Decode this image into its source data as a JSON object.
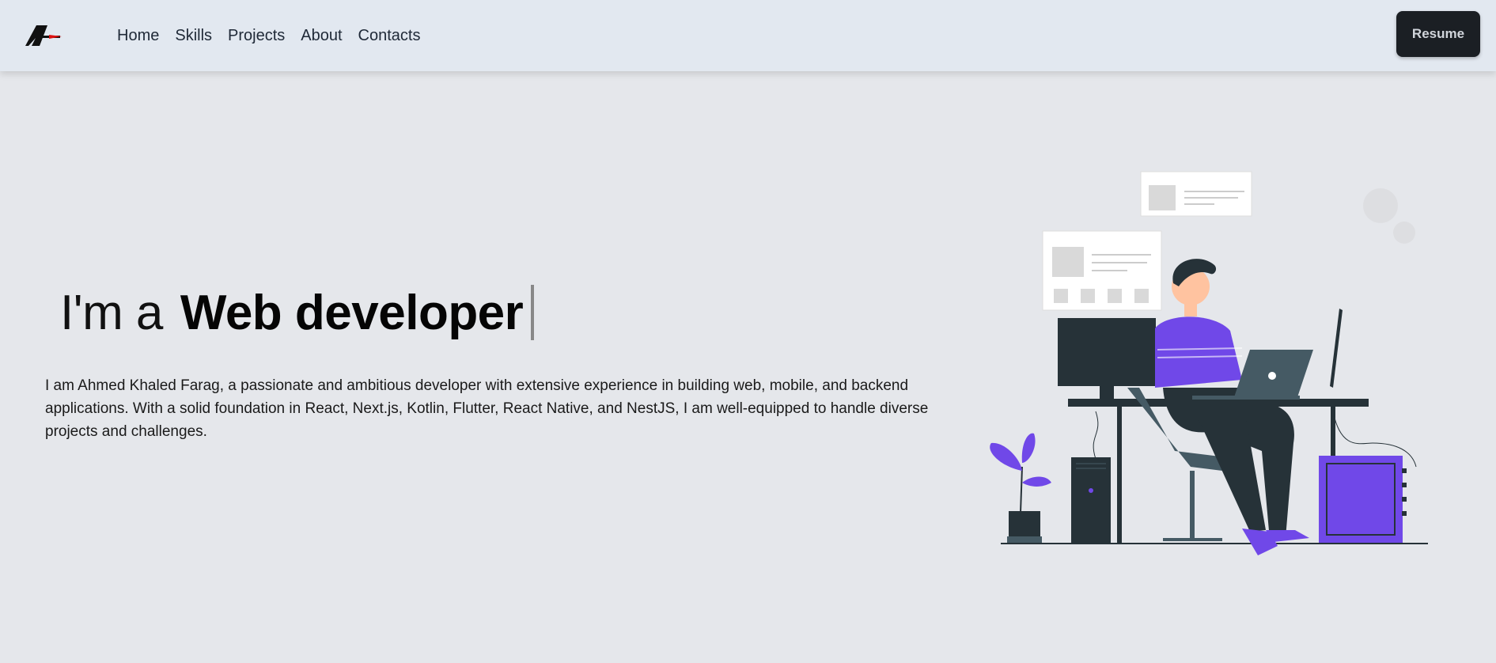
{
  "nav": {
    "logo_icon": "stylized-A-logo-icon",
    "links": [
      "Home",
      "Skills",
      "Projects",
      "About",
      "Contacts"
    ],
    "resume_label": "Resume"
  },
  "hero": {
    "prefix": "I'm a",
    "role": "Web developer",
    "intro": "I am Ahmed Khaled Farag, a passionate and ambitious developer with extensive experience in building web, mobile, and backend applications. With a solid foundation in React, Next.js, Kotlin, Flutter, React Native, and NestJS, I am well-equipped to handle diverse projects and challenges."
  },
  "colors": {
    "nav_bg": "#e2e8f0",
    "page_bg": "#e5e7eb",
    "button_bg": "#1b1f24",
    "accent_purple": "#7048e8",
    "dark": "#263238"
  }
}
